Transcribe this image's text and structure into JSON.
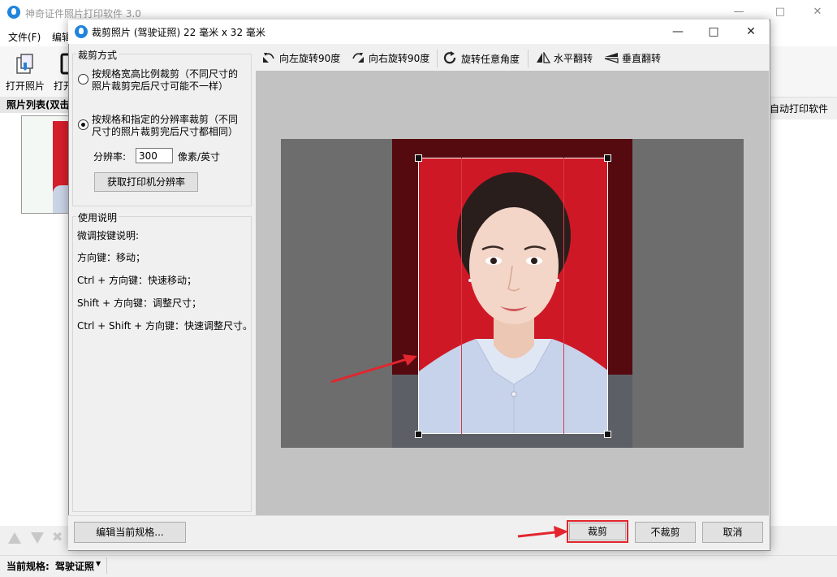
{
  "main_window": {
    "title": "神奇证件照片打印软件 3.0",
    "menu": [
      "文件(F)",
      "编辑"
    ],
    "toolbar": [
      {
        "label": "打开照片",
        "icon": "open-photo-icon"
      },
      {
        "label": "打开",
        "icon": "open-folder-icon"
      }
    ],
    "photo_list_label": "照片列表(双击",
    "right_panel_text": "自动打印软件",
    "status": {
      "label": "当前规格:",
      "value": "驾驶证照"
    }
  },
  "dialog": {
    "title": "裁剪照片 (驾驶证照) 22 毫米 x 32 毫米",
    "crop_mode": {
      "legend": "裁剪方式",
      "option1_line1": "按规格宽高比例裁剪（不同尺寸的",
      "option1_line2": "照片裁剪完后尺寸可能不一样）",
      "option2_line1": "按规格和指定的分辨率裁剪（不同",
      "option2_line2": "尺寸的照片裁剪完后尺寸都相同）",
      "selected": 2,
      "resolution_label": "分辨率:",
      "resolution_value": "300",
      "resolution_unit": "像素/英寸",
      "get_printer_button": "获取打印机分辨率"
    },
    "help": {
      "legend": "使用说明",
      "lines": [
        "微调按键说明:",
        "方向键：移动；",
        "Ctrl + 方向键：快速移动；",
        "Shift + 方向键：调整尺寸；",
        "Ctrl + Shift + 方向键：快速调整尺寸。"
      ]
    },
    "edit_toolbar": {
      "rotate_left": "向左旋转90度",
      "rotate_right": "向右旋转90度",
      "rotate_any": "旋转任意角度",
      "flip_h": "水平翻转",
      "flip_v": "垂直翻转"
    },
    "buttons": {
      "edit_spec": "编辑当前规格...",
      "crop": "裁剪",
      "no_crop": "不裁剪",
      "cancel": "取消"
    }
  },
  "colors": {
    "accent_red": "#e3262e",
    "photo_background": "#cf1826",
    "app_blue": "#1f84dc"
  }
}
